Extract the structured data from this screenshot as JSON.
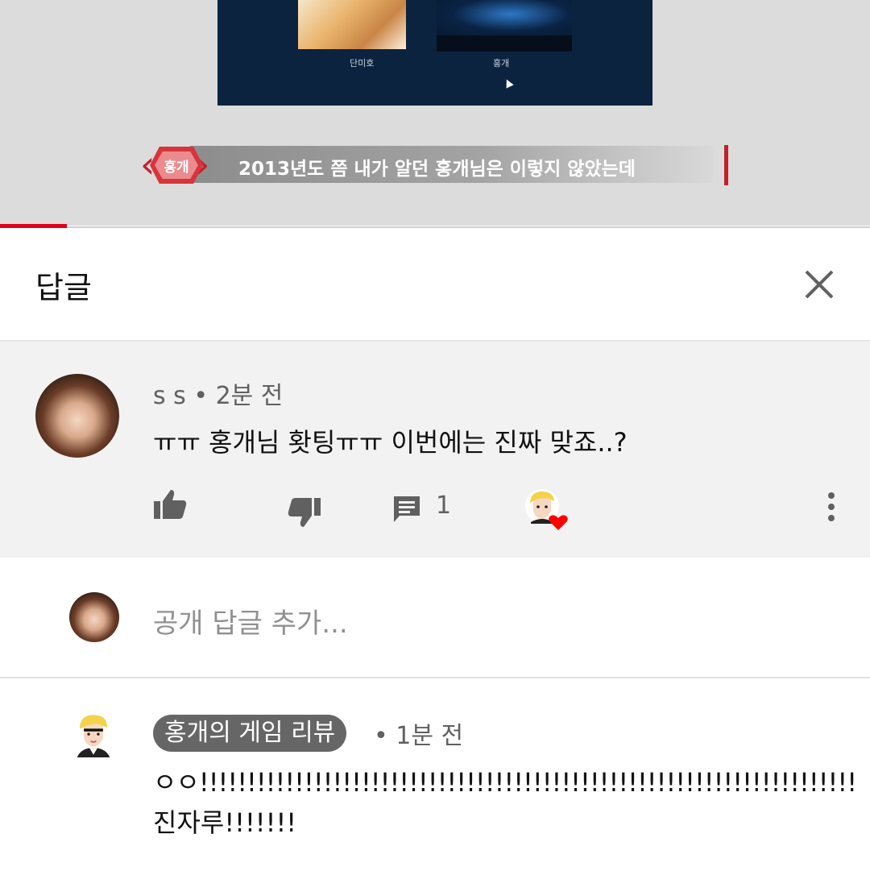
{
  "video": {
    "caption_left": "단미호",
    "caption_right": "홍개",
    "banner_tag": "홍개",
    "banner_text": "2013년도 쯤 내가 알던 홍개님은 이렇지 않았는데",
    "progress": 0.077
  },
  "header": {
    "title": "답글"
  },
  "parent_comment": {
    "author": "s s",
    "time": "2분 전",
    "text": "ㅠㅠ 홍개님 홧팅ㅠㅠ 이번에는 진짜 맞죠..?",
    "reply_count": "1"
  },
  "add_reply": {
    "placeholder": "공개 답글 추가..."
  },
  "reply": {
    "author": "홍개의 게임 리뷰",
    "time": "1분 전",
    "line1": "ㅇㅇ!!!!!!!!!!!!!!!!!!!!!!!!!!!!!!!!!!!!!!!!!!!!!!!!!!!!!!!!!!!!!!!!!!!!!",
    "line2": "진자루!!!!!!!"
  },
  "colors": {
    "accent_red": "#e0001a",
    "heart": "#ff0000"
  }
}
